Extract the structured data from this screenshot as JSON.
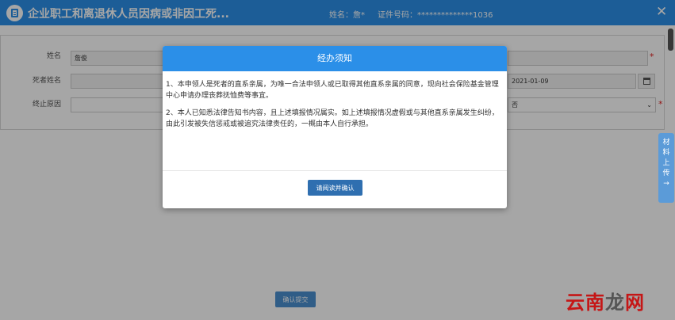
{
  "header": {
    "title": "企业职工和离退休人员因病或非因工死...",
    "name_label": "姓名：",
    "name_value": "詹*",
    "id_label": "证件号码：",
    "id_value": "**************1036",
    "close": "✕"
  },
  "form": {
    "name_label": "姓名",
    "name_value": "詹俊",
    "deceased_label": "死者姓名",
    "termination_label": "终止原因",
    "date_value": "2021-01-09",
    "select_value": "否",
    "required_mark": "*"
  },
  "modal": {
    "title": "经办须知",
    "paragraphs": [
      "1、本申领人是死者的直系亲属，为唯一合法申领人或已取得其他直系亲属的同意，现向社会保险基金管理中心申请办理丧葬抚恤费等事宜。",
      "2、本人已知悉法律告知书内容，且上述填报情况属实。如上述填报情况虚假或与其他直系亲属发生纠纷，由此引发被失信惩戒或被追究法律责任的，一概由本人自行承担。"
    ],
    "confirm_button": "请阅读并确认"
  },
  "side_upload": {
    "chars": [
      "材",
      "料",
      "上",
      "传",
      "→"
    ]
  },
  "footer": {
    "submit_button": "确认提交"
  },
  "watermark": {
    "red": "云南",
    "gray": "龙",
    "red2": "网"
  }
}
